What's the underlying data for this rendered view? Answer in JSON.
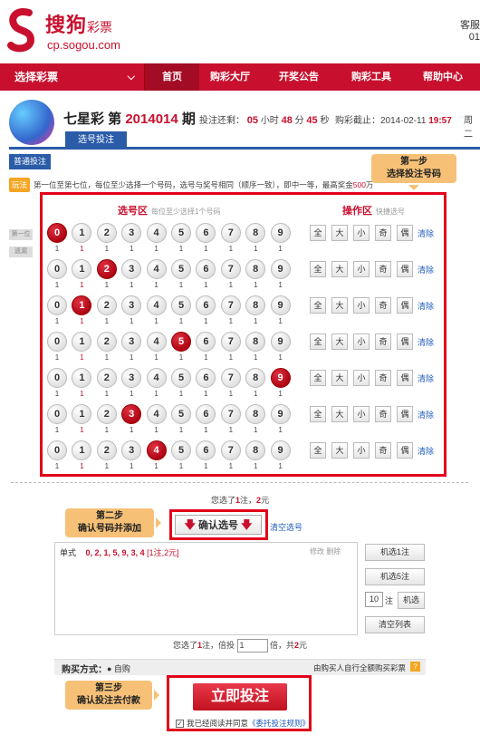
{
  "header": {
    "logo_cn": "搜狗",
    "logo_cp": "彩票",
    "logo_url": "cp.sogou.com",
    "service_line1": "客服",
    "service_line2": "01"
  },
  "nav": {
    "select_label": "选择彩票",
    "items": [
      "首页",
      "购彩大厅",
      "开奖公告",
      "购彩工具",
      "帮助中心"
    ],
    "active_index": 0
  },
  "game": {
    "name": "七星彩 第",
    "issue": "2014014",
    "issue_suffix": "期",
    "countdown_label": "投注还剩：",
    "hours": "05",
    "hours_unit": "小时",
    "minutes": "48",
    "minutes_unit": "分",
    "seconds": "45",
    "seconds_unit": "秒",
    "deadline_label": "购彩截止：2014-02-11",
    "deadline_time": "19:57",
    "weekday": "周二",
    "tab": "选号投注",
    "play_type": "普通投注"
  },
  "rule": {
    "tag": "玩法",
    "text": "第一位至第七位，每位至少选择一个号码，选号与奖号相同（顺序一致），即中一等，最高奖金",
    "prize": "500",
    "prize_unit": "万"
  },
  "step1": {
    "line1": "第一步",
    "line2": "选择投注号码"
  },
  "step2": {
    "line1": "第二步",
    "line2": "确认号码并添加"
  },
  "step3": {
    "line1": "第三步",
    "line2": "确认投注去付款"
  },
  "picker": {
    "title": "选号区",
    "subtitle": "每位至少选择1个号码",
    "ops_title": "操作区",
    "ops_subtitle": "快捷选号",
    "side_labels": [
      "第一位",
      "遗漏"
    ],
    "digits": [
      "0",
      "1",
      "2",
      "3",
      "4",
      "5",
      "6",
      "7",
      "8",
      "9"
    ],
    "selected": [
      0,
      2,
      1,
      5,
      9,
      3,
      4
    ],
    "miss": [
      [
        "1",
        "1",
        "1",
        "1",
        "1",
        "1",
        "1",
        "1",
        "1",
        "1"
      ],
      [
        "1",
        "1",
        "1",
        "1",
        "1",
        "1",
        "1",
        "1",
        "1",
        "1"
      ],
      [
        "1",
        "1",
        "1",
        "1",
        "1",
        "1",
        "1",
        "1",
        "1",
        "1"
      ],
      [
        "1",
        "1",
        "1",
        "1",
        "1",
        "1",
        "1",
        "1",
        "1",
        "1"
      ],
      [
        "1",
        "1",
        "1",
        "1",
        "1",
        "1",
        "1",
        "1",
        "1",
        "1"
      ],
      [
        "1",
        "1",
        "1",
        "1",
        "1",
        "1",
        "1",
        "1",
        "1",
        "1"
      ],
      [
        "1",
        "1",
        "1",
        "1",
        "1",
        "1",
        "1",
        "1",
        "1",
        "1"
      ]
    ],
    "ops": [
      "全",
      "大",
      "小",
      "奇",
      "偶"
    ],
    "clear": "清除"
  },
  "selection_summary": {
    "prefix": "您选了",
    "count": "1",
    "mid": "注，",
    "amount": "2",
    "suffix": "元"
  },
  "confirm": {
    "label": "确认选号",
    "clear_link": "清空选号"
  },
  "list": {
    "label": "单式",
    "numbers": "0, 2, 1, 5, 9, 3, 4",
    "detail": "[1注,2元]",
    "ops": "修改 删除"
  },
  "side_buttons": {
    "random1": "机选1注",
    "random5": "机选5注",
    "random_count": "10",
    "random_unit": "注",
    "random_n": "机选",
    "clear_list": "清空列表"
  },
  "multiplier": {
    "prefix": "您选了",
    "count": "1",
    "mid": "注，倍投",
    "value": "1",
    "suffix1": "倍，共",
    "total": "2",
    "suffix2": "元"
  },
  "payment": {
    "label": "购买方式：",
    "auto": "● 自购",
    "right_text": "由购买人自行全额购买彩票",
    "help": "?"
  },
  "bet": {
    "label": "立即投注",
    "agree_check": "✓",
    "agree_text": "我已经阅读并同意",
    "agree_link": "《委托投注规则》"
  },
  "colors": {
    "brand_red": "#c8102e",
    "accent_blue": "#2a5ca8",
    "callout": "#f6c177"
  }
}
